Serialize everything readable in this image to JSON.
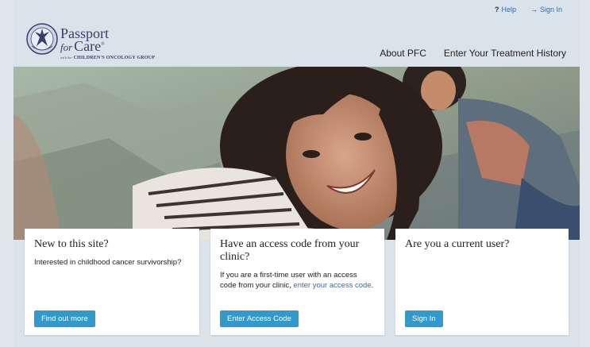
{
  "util": {
    "help_icon": "?",
    "help": "Help",
    "signin_icon": "→",
    "signin": "Sign In"
  },
  "logo": {
    "line1": "Passport",
    "line2_for": "for",
    "line2": "Care",
    "mark": "®",
    "line3_prefix": "with the",
    "line3": "CHILDREN'S ONCOLOGY GROUP"
  },
  "nav": {
    "about": "About PFC",
    "enter_history": "Enter Your Treatment History"
  },
  "cards": [
    {
      "title": "New to this site?",
      "body": "Interested in childhood cancer survivorship?",
      "button": "Find out more"
    },
    {
      "title": "Have an access code from your clinic?",
      "body_prefix": "If you are a first-time user with an access code from your clinic, ",
      "body_link": "enter your access code",
      "body_suffix": ".",
      "button": "Enter Access Code"
    },
    {
      "title": "Are you a current user?",
      "button": "Sign In"
    }
  ],
  "colors": {
    "accent": "#3399cc",
    "link": "#2b6cb5",
    "brand": "#3a3e6a"
  }
}
